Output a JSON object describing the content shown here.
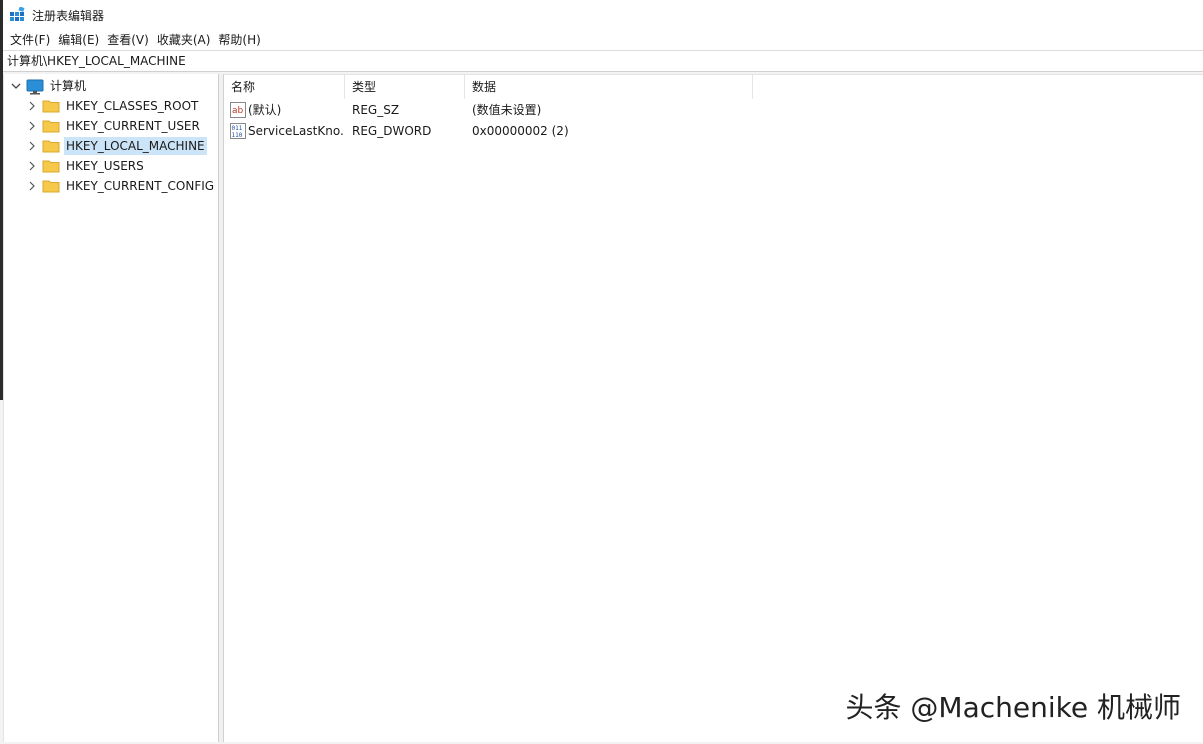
{
  "window": {
    "title": "注册表编辑器"
  },
  "menu": [
    "文件(F)",
    "编辑(E)",
    "查看(V)",
    "收藏夹(A)",
    "帮助(H)"
  ],
  "address": "计算机\\HKEY_LOCAL_MACHINE",
  "tree": {
    "root": "计算机",
    "items": [
      {
        "label": "HKEY_CLASSES_ROOT",
        "selected": false
      },
      {
        "label": "HKEY_CURRENT_USER",
        "selected": false
      },
      {
        "label": "HKEY_LOCAL_MACHINE",
        "selected": true
      },
      {
        "label": "HKEY_USERS",
        "selected": false
      },
      {
        "label": "HKEY_CURRENT_CONFIG",
        "selected": false
      }
    ]
  },
  "list": {
    "columns": [
      "名称",
      "类型",
      "数据"
    ],
    "rows": [
      {
        "icon": "string-value-icon",
        "name": "(默认)",
        "type": "REG_SZ",
        "data": "(数值未设置)"
      },
      {
        "icon": "binary-value-icon",
        "name": "ServiceLastKno...",
        "type": "REG_DWORD",
        "data": "0x00000002 (2)"
      }
    ]
  },
  "watermark": "头条 @Machenike 机械师",
  "colors": {
    "selection": "#cce4f7",
    "folder": "#f6c94a",
    "computer_icon": "#2a8fd6"
  }
}
